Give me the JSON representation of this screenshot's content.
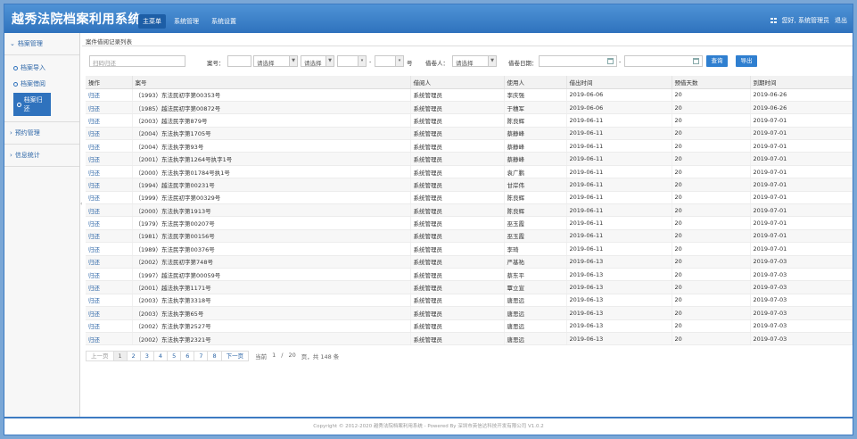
{
  "app": {
    "title": "越秀法院档案利用系统",
    "nav": [
      "主菜单",
      "系统管理",
      "系统设置"
    ],
    "greeting": "您好, 系统管理员",
    "logout": "退出"
  },
  "sidebar": {
    "group1": "档案管理",
    "items": [
      "档案导入",
      "档案借阅",
      "档案归还"
    ],
    "group2": "预约管理",
    "group3": "信息统计"
  },
  "breadcrumb": "案件借阅记录列表",
  "filters": {
    "scan_placeholder": "扫码归还",
    "case_no_label": "案号：",
    "select1": "请选择",
    "select2": "请选择",
    "dash": "-",
    "hao": "号",
    "borrower_label": "借卷人：",
    "borrower_select": "请选择",
    "date_label": "借卷日期：",
    "search_btn": "查询",
    "export_btn": "导出"
  },
  "table": {
    "headers": [
      "操作",
      "案号",
      "借阅人",
      "使用人",
      "借出时间",
      "预借天数",
      "到期时间"
    ],
    "op_label": "归还",
    "rows": [
      [
        "（1993）东法民初字第00353号",
        "系统管理员",
        "李庆强",
        "2019-06-06",
        "20",
        "2019-06-26"
      ],
      [
        "（1985）越法民初字第00872号",
        "系统管理员",
        "于穗军",
        "2019-06-06",
        "20",
        "2019-06-26"
      ],
      [
        "（2003）越法民字第879号",
        "系统管理员",
        "陈良辉",
        "2019-06-11",
        "20",
        "2019-07-01"
      ],
      [
        "（2004）东法执字第1705号",
        "系统管理员",
        "蔡静峰",
        "2019-06-11",
        "20",
        "2019-07-01"
      ],
      [
        "（2004）东法执字第93号",
        "系统管理员",
        "蔡静峰",
        "2019-06-11",
        "20",
        "2019-07-01"
      ],
      [
        "（2001）东法执字第1264号执字1号",
        "系统管理员",
        "蔡静峰",
        "2019-06-11",
        "20",
        "2019-07-01"
      ],
      [
        "（2000）东法执字第01784号执1号",
        "系统管理员",
        "袁广鹏",
        "2019-06-11",
        "20",
        "2019-07-01"
      ],
      [
        "（1994）越法民字第00231号",
        "系统管理员",
        "甘岸伟",
        "2019-06-11",
        "20",
        "2019-07-01"
      ],
      [
        "（1999）东法民初字第00329号",
        "系统管理员",
        "陈良辉",
        "2019-06-11",
        "20",
        "2019-07-01"
      ],
      [
        "（2000）东法执字第1913号",
        "系统管理员",
        "陈良辉",
        "2019-06-11",
        "20",
        "2019-07-01"
      ],
      [
        "（1979）东法民字第00207号",
        "系统管理员",
        "巫玉霞",
        "2019-06-11",
        "20",
        "2019-07-01"
      ],
      [
        "（1981）东法民字第00156号",
        "系统管理员",
        "巫玉霞",
        "2019-06-11",
        "20",
        "2019-07-01"
      ],
      [
        "（1989）东法民字第00376号",
        "系统管理员",
        "李琦",
        "2019-06-11",
        "20",
        "2019-07-01"
      ],
      [
        "（2002）东法民初字第748号",
        "系统管理员",
        "严基祐",
        "2019-06-13",
        "20",
        "2019-07-03"
      ],
      [
        "（1997）越法民初字第00059号",
        "系统管理员",
        "蔡东平",
        "2019-06-13",
        "20",
        "2019-07-03"
      ],
      [
        "（2001）越法执字第1171号",
        "系统管理员",
        "覃立宣",
        "2019-06-13",
        "20",
        "2019-07-03"
      ],
      [
        "（2003）东法执字第3318号",
        "系统管理员",
        "唐思远",
        "2019-06-13",
        "20",
        "2019-07-03"
      ],
      [
        "（2003）东法执字第65号",
        "系统管理员",
        "唐思远",
        "2019-06-13",
        "20",
        "2019-07-03"
      ],
      [
        "（2002）东法执字第2527号",
        "系统管理员",
        "唐思远",
        "2019-06-13",
        "20",
        "2019-07-03"
      ],
      [
        "（2002）东法执字第2321号",
        "系统管理员",
        "唐思远",
        "2019-06-13",
        "20",
        "2019-07-03"
      ]
    ]
  },
  "pager": {
    "prev": "上一页",
    "pages": [
      "1",
      "2",
      "3",
      "4",
      "5",
      "6",
      "7",
      "8"
    ],
    "next": "下一页",
    "current_label": "当前",
    "current": "1",
    "slash": "/",
    "total_pages": "20",
    "total_text": "页，共 148 条"
  },
  "footer": "Copyright © 2012-2020 越秀法院档案利用系统 - Powered By 深圳市英信达科技开发有限公司 V1.0.2"
}
